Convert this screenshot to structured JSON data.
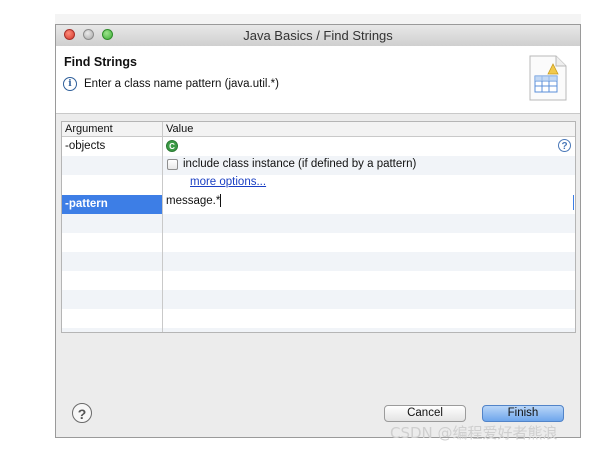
{
  "window": {
    "title": "Java Basics / Find Strings"
  },
  "header": {
    "title": "Find Strings",
    "message": "Enter a class name pattern (java.util.*)",
    "info_glyph": "i"
  },
  "table": {
    "columns": [
      "Argument",
      "Value"
    ],
    "rows": [
      {
        "argument": "-objects",
        "class_glyph": "C"
      },
      {
        "argument": "-pattern",
        "value": "message.*"
      }
    ],
    "checkbox_label": "include class instance (if defined by a pattern)",
    "checkbox_checked": false,
    "more_options": "more options...",
    "help_glyph": "?"
  },
  "footer": {
    "help_glyph": "?",
    "cancel_label": "Cancel",
    "finish_label": "Finish"
  },
  "watermark": "CSDN @编程爱好者熊浪",
  "colors": {
    "selection": "#3d7ee6",
    "link": "#1a3fc4",
    "class_icon": "#3b9a45",
    "finish_button": "#6fa6ec"
  }
}
